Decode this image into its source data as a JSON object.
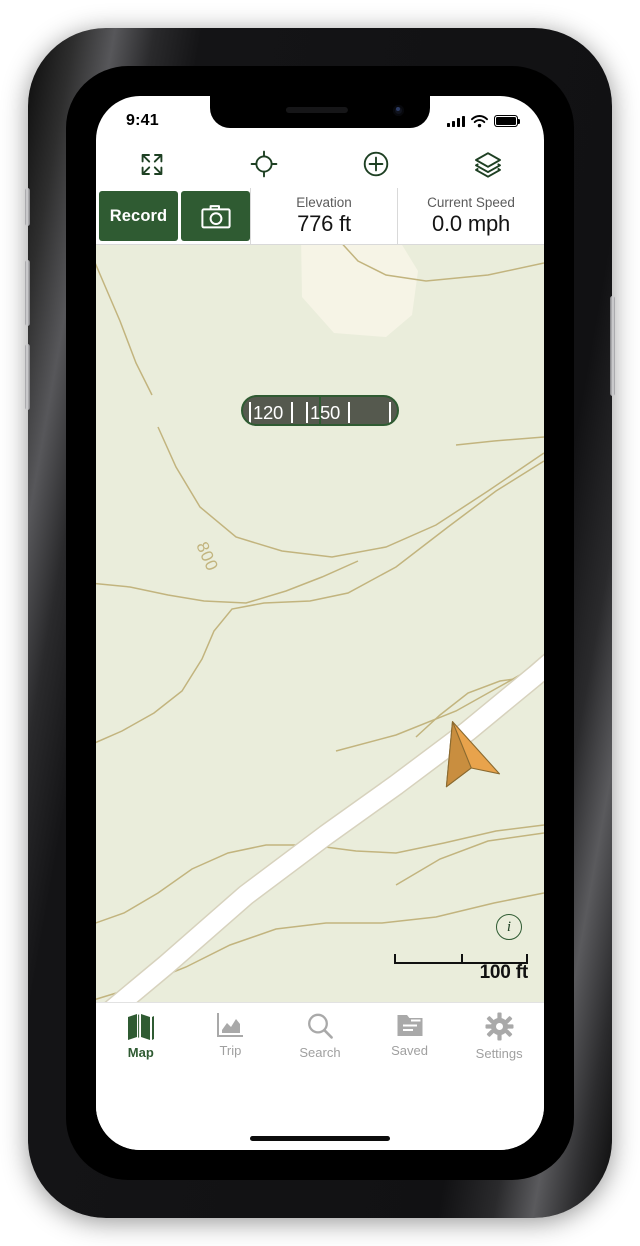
{
  "status_bar": {
    "time": "9:41",
    "cellular_icon": "signal-bars-icon",
    "wifi_icon": "wifi-icon",
    "battery_icon": "battery-icon"
  },
  "map_tools": [
    {
      "name": "expand-icon",
      "label": "Expand"
    },
    {
      "name": "locate-icon",
      "label": "Locate"
    },
    {
      "name": "add-icon",
      "label": "Add"
    },
    {
      "name": "layers-icon",
      "label": "Layers"
    }
  ],
  "toolbar": {
    "record_label": "Record",
    "camera_icon": "camera-icon",
    "accent_color": "#2f5b32",
    "stats": [
      {
        "label": "Elevation",
        "value": "776 ft"
      },
      {
        "label": "Current Speed",
        "value": "0.0 mph"
      }
    ]
  },
  "compass": {
    "labels": [
      "120",
      "150"
    ],
    "heading": 137,
    "background_color": "#55594e",
    "border_color": "#2f5b32"
  },
  "map": {
    "background_color": "#eaeddb",
    "contour_color": "#c2b47e",
    "road_color": "#ffffff",
    "clearing_color": "#f5f3e4",
    "position_marker_color": "#e8a34c",
    "contour_labels": [
      "800"
    ],
    "info_button": "i",
    "scale": {
      "label": "100 ft",
      "ticks": 3
    }
  },
  "tab_bar": {
    "items": [
      {
        "label": "Map",
        "icon": "map-icon",
        "active": true
      },
      {
        "label": "Trip",
        "icon": "chart-icon",
        "active": false
      },
      {
        "label": "Search",
        "icon": "search-icon",
        "active": false
      },
      {
        "label": "Saved",
        "icon": "folder-icon",
        "active": false
      },
      {
        "label": "Settings",
        "icon": "gear-icon",
        "active": false
      }
    ],
    "active_color": "#2f5b32",
    "inactive_color": "#a0a0a0"
  }
}
